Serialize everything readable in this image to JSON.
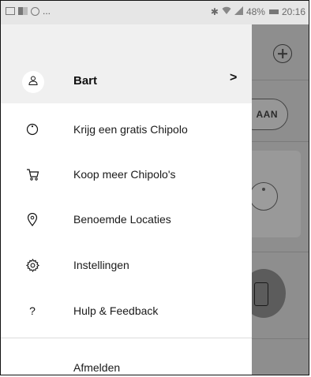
{
  "status_bar": {
    "ellipsis": "...",
    "battery": "48%",
    "time": "20:16"
  },
  "drawer": {
    "profile": {
      "name": "Bart",
      "chevron": ">"
    },
    "items": [
      {
        "label": "Krijg een gratis Chipolo",
        "icon": "chipolo-icon"
      },
      {
        "label": "Koop meer Chipolo's",
        "icon": "cart-icon"
      },
      {
        "label": "Benoemde Locaties",
        "icon": "location-pin-icon"
      },
      {
        "label": "Instellingen",
        "icon": "gear-icon"
      },
      {
        "label": "Hulp & Feedback",
        "icon": "help-icon",
        "glyph": "?"
      }
    ],
    "logout": "Afmelden"
  },
  "background_app": {
    "pill_text": "AAN"
  }
}
